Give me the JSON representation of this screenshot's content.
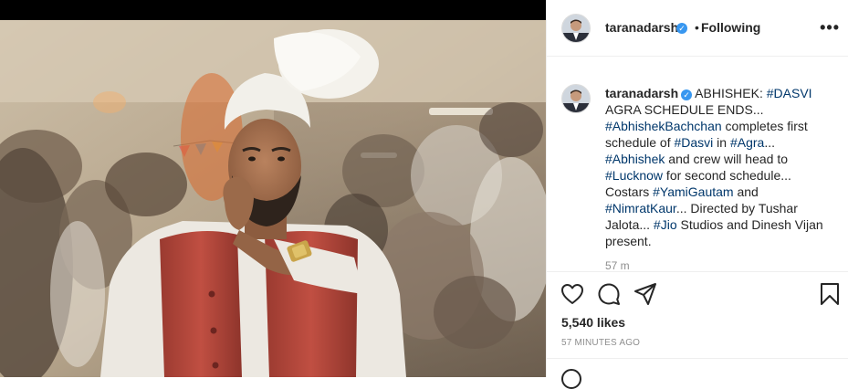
{
  "post": {
    "image_alt": "Man in white turban and red vest with a crowd behind him"
  },
  "header": {
    "username": "taranadarsh",
    "verified_icon": "verified-badge-icon",
    "separator": "•",
    "follow_status": "Following",
    "more_label": "•••"
  },
  "caption": {
    "username": "taranadarsh",
    "parts": {
      "p1": "ABHISHEK: ",
      "t1": "#DASVI",
      "p2": " AGRA SCHEDULE ENDS... ",
      "t2": "#AbhishekBachchan",
      "p3": " completes first schedule of ",
      "t3": "#Dasvi",
      "p4": " in ",
      "t4": "#Agra",
      "p5": "... ",
      "t5": "#Abhishek",
      "p6": " and crew will head to ",
      "t6": "#Lucknow",
      "p7": " for second schedule... Costars ",
      "t7": "#YamiGautam",
      "p8": " and ",
      "t8": "#NimratKaur",
      "p9": "... Directed by Tushar Jalota... ",
      "t9": "#Jio",
      "p10": " Studios and Dinesh Vijan present."
    },
    "age": "57 m"
  },
  "actions": {
    "like_icon": "heart-icon",
    "comment_icon": "comment-icon",
    "share_icon": "share-icon",
    "save_icon": "bookmark-icon"
  },
  "likes_text": "5,540 likes",
  "posted_time": "57 minutes ago",
  "colors": {
    "hashtag": "#00376b",
    "verified": "#3897f0",
    "muted": "#8e8e8e",
    "text": "#262626",
    "vest": "#b8473a",
    "turban": "#f2f0ea"
  }
}
